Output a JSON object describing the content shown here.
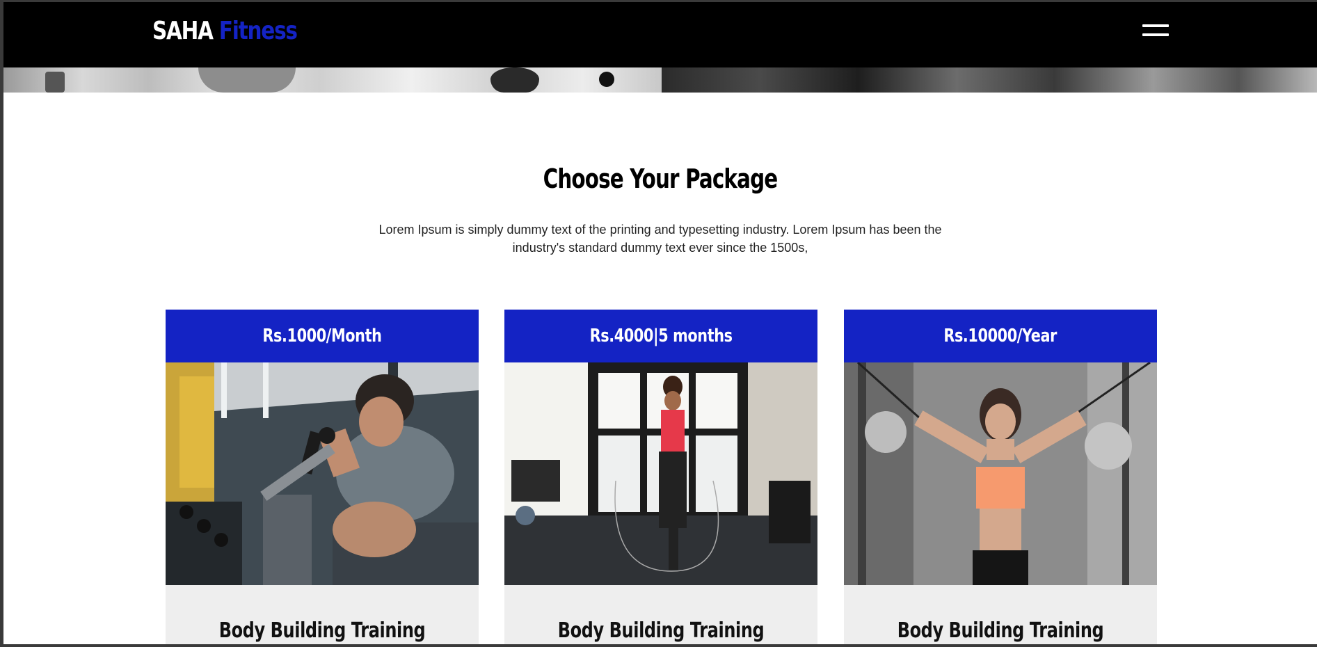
{
  "brand": {
    "name_part1": "SAHA",
    "name_part2": "Fitness",
    "accent": "#1423c4"
  },
  "nav": {
    "menu_icon": "hamburger-menu-icon"
  },
  "section": {
    "title": "Choose Your Package",
    "description": "Lorem Ipsum is simply dummy text of the printing and typesetting industry. Lorem Ipsum has been the industry's standard dummy text ever since the 1500s,"
  },
  "packages": [
    {
      "price": "Rs.1000/Month",
      "title": "Body Building Training"
    },
    {
      "price": "Rs.4000|5 months",
      "title": "Body Building Training"
    },
    {
      "price": "Rs.10000/Year",
      "title": "Body Building Training"
    }
  ],
  "colors": {
    "header_bg": "#000000",
    "card_header": "#1423c4",
    "card_body": "#eeeeee"
  }
}
